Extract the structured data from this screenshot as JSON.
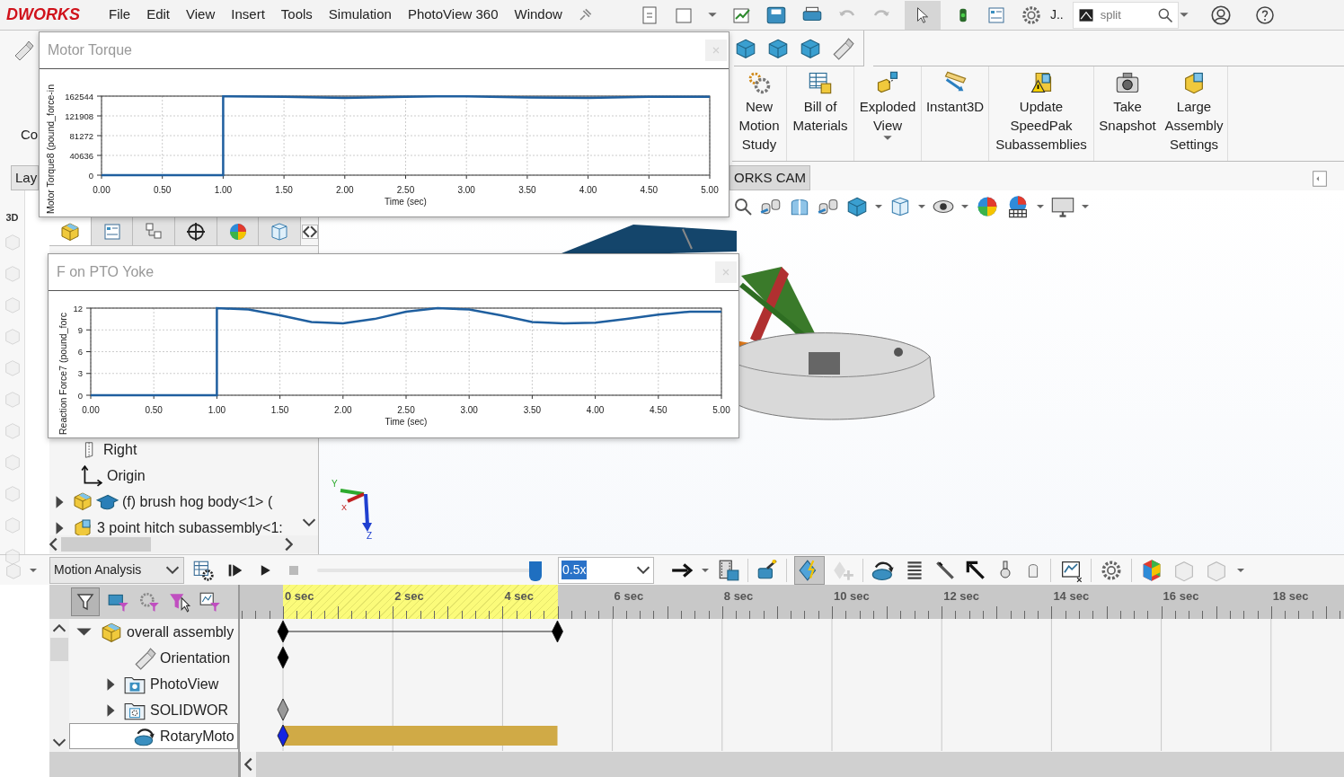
{
  "menu_bar": {
    "logo": "DWORKS",
    "items": [
      "File",
      "Edit",
      "View",
      "Insert",
      "Tools",
      "Simulation",
      "PhotoView 360",
      "Window"
    ],
    "user_text": "J..",
    "search": {
      "value": "split"
    }
  },
  "command_manager": {
    "partial_label": "Co",
    "items": [
      {
        "label": "New Motion Study",
        "dropdown": false
      },
      {
        "label": "Bill of Materials",
        "dropdown": false
      },
      {
        "label": "Exploded View",
        "dropdown": true
      },
      {
        "label": "Instant3D",
        "dropdown": false
      },
      {
        "label": "Update SpeedPak Subassemblies",
        "dropdown": false
      },
      {
        "label": "Take Snapshot",
        "dropdown": false
      },
      {
        "label": "Large Assembly Settings",
        "dropdown": false
      }
    ]
  },
  "tabs": [
    {
      "label": "Lay"
    },
    {
      "label": "ORKS CAM"
    }
  ],
  "feature_manager": {
    "side_label": "3D",
    "tabs": [
      {
        "selected": true
      },
      {
        "selected": false
      },
      {
        "selected": false
      },
      {
        "selected": false
      },
      {
        "selected": false
      },
      {
        "selected": false
      }
    ],
    "tree": [
      {
        "label": "Right",
        "kind": "plane"
      },
      {
        "label": "Origin",
        "kind": "origin"
      },
      {
        "label": "(f) brush hog body<1> (",
        "kind": "part",
        "expanded": false
      },
      {
        "label": "3 point hitch subassembly<1:",
        "kind": "assembly",
        "expanded": false
      }
    ]
  },
  "triad": [
    "Y",
    "X",
    "Z"
  ],
  "motion_manager": {
    "study_type": "Motion Analysis",
    "autokey": true,
    "filter_animated": true,
    "playback": {
      "level": 1
    },
    "speed": "0.5x",
    "ruler": [
      "0 sec",
      "2 sec",
      "4 sec",
      "6 sec",
      "8 sec",
      "10 sec",
      "12 sec",
      "14 sec",
      "16 sec",
      "18 sec"
    ],
    "rows": [
      {
        "label": "overall assembly",
        "kind": "assembly",
        "expanded": true,
        "selected": false,
        "start_key": true,
        "end_key": true,
        "key_suppressed": false,
        "motor_bar": false
      },
      {
        "label": "Orientation",
        "kind": "orientation",
        "selected": false,
        "start_key": true,
        "end_key": false,
        "key_suppressed": false,
        "motor_bar": false
      },
      {
        "label": "PhotoView",
        "kind": "folder_photo",
        "expanded": false,
        "selected": false,
        "start_key": false,
        "end_key": false,
        "motor_bar": false
      },
      {
        "label": "SOLIDWOR",
        "kind": "folder_gear",
        "expanded": false,
        "selected": false,
        "start_key": true,
        "end_key": false,
        "key_suppressed": true,
        "motor_bar": false
      },
      {
        "label": "RotaryMoto",
        "kind": "motor",
        "selected": true,
        "start_key": true,
        "end_key": false,
        "key_suppressed": false,
        "motor_bar": true
      }
    ]
  },
  "plot_windows": [
    {
      "title": "Motor Torque",
      "chart_data": {
        "type": "line",
        "grid": true,
        "xlabel": "Time (sec)",
        "ylabel": "Motor Torque8 (pound_force-in",
        "x": [
          0,
          1,
          1,
          1.5,
          2,
          2.5,
          2.75,
          3,
          3.5,
          4,
          4.5,
          5
        ],
        "series": [
          {
            "color": "#1f5f9f",
            "values": [
              0,
              0,
              162000,
              161000,
              159000,
              161000,
              162000,
              162000,
              160000,
              159000,
              161000,
              161000
            ]
          }
        ],
        "xlim": [
          0,
          5
        ],
        "ylim": [
          0,
          162544
        ],
        "xticks": [
          {
            "value": 0,
            "label": "0.00"
          },
          {
            "value": 0.5,
            "label": "0.50"
          },
          {
            "value": 1,
            "label": "1.00"
          },
          {
            "value": 1.5,
            "label": "1.50"
          },
          {
            "value": 2,
            "label": "2.00"
          },
          {
            "value": 2.5,
            "label": "2.50"
          },
          {
            "value": 3,
            "label": "3.00"
          },
          {
            "value": 3.5,
            "label": "3.50"
          },
          {
            "value": 4,
            "label": "4.00"
          },
          {
            "value": 4.5,
            "label": "4.50"
          },
          {
            "value": 5,
            "label": "5.00"
          }
        ],
        "yticks": [
          0,
          40636,
          81272,
          121908,
          162544
        ]
      }
    },
    {
      "title": "F on PTO Yoke",
      "chart_data": {
        "type": "line",
        "grid": true,
        "xlabel": "Time (sec)",
        "ylabel": "Reaction Force7 (pound_forc",
        "x": [
          0,
          1,
          1,
          1.25,
          1.5,
          1.75,
          2,
          2.25,
          2.5,
          2.75,
          3,
          3.25,
          3.5,
          3.75,
          4,
          4.25,
          4.5,
          4.75,
          5
        ],
        "series": [
          {
            "color": "#1f5f9f",
            "values": [
              0,
              0,
              12,
              11.8,
              11,
              10.1,
              9.9,
              10.5,
              11.5,
              12,
              11.8,
              11,
              10.1,
              9.9,
              10,
              10.5,
              11.1,
              11.5,
              11.5
            ]
          }
        ],
        "xlim": [
          0,
          5
        ],
        "ylim": [
          0,
          12
        ],
        "xticks": [
          {
            "value": 0,
            "label": "0.00"
          },
          {
            "value": 0.5,
            "label": "0.50"
          },
          {
            "value": 1,
            "label": "1.00"
          },
          {
            "value": 1.5,
            "label": "1.50"
          },
          {
            "value": 2,
            "label": "2.00"
          },
          {
            "value": 2.5,
            "label": "2.50"
          },
          {
            "value": 3,
            "label": "3.00"
          },
          {
            "value": 3.5,
            "label": "3.50"
          },
          {
            "value": 4,
            "label": "4.00"
          },
          {
            "value": 4.5,
            "label": "4.50"
          },
          {
            "value": 5,
            "label": "5.00"
          }
        ],
        "yticks": [
          0,
          3,
          6,
          9,
          12
        ]
      }
    }
  ]
}
